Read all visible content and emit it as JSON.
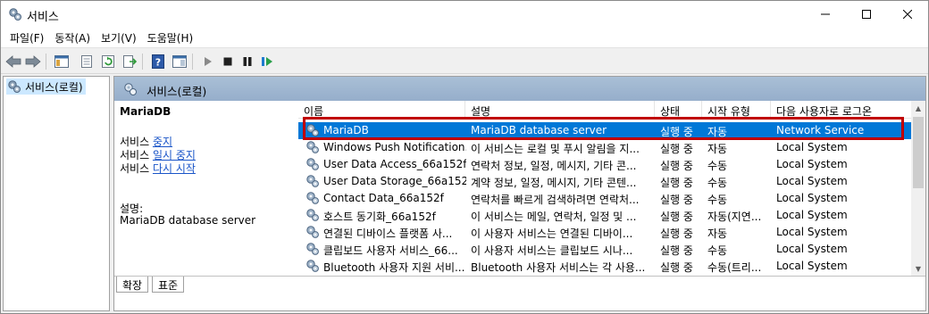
{
  "window": {
    "title": "서비스"
  },
  "menu": [
    "파일(F)",
    "동작(A)",
    "보기(V)",
    "도움말(H)"
  ],
  "tree": {
    "root": "서비스(로컬)"
  },
  "content_header": {
    "title": "서비스(로컬)"
  },
  "detail": {
    "service_name": "MariaDB",
    "actions": [
      {
        "prefix": "서비스 ",
        "link": "중지"
      },
      {
        "prefix": "서비스 ",
        "link": "일시 중지"
      },
      {
        "prefix": "서비스 ",
        "link": "다시 시작"
      }
    ],
    "desc_label": "설명:",
    "desc_text": "MariaDB database server"
  },
  "list": {
    "columns": [
      "이름",
      "설명",
      "상태",
      "시작 유형",
      "다음 사용자로 로그온"
    ],
    "rows": [
      [
        "MariaDB",
        "MariaDB database server",
        "실행 중",
        "자동",
        "Network Service"
      ],
      [
        "Windows Push Notification...",
        "이 서비스는 로컬 및 푸시 알림을 지...",
        "실행 중",
        "자동",
        "Local System"
      ],
      [
        "User Data Access_66a152f",
        "연락처 정보, 일정, 메시지, 기타 콘...",
        "실행 중",
        "수동",
        "Local System"
      ],
      [
        "User Data Storage_66a152f",
        "계약 정보, 일정, 메시지, 기타 콘텐...",
        "실행 중",
        "수동",
        "Local System"
      ],
      [
        "Contact Data_66a152f",
        "연락처를 빠르게 검색하려면 연락처...",
        "실행 중",
        "수동",
        "Local System"
      ],
      [
        "호스트 동기화_66a152f",
        "이 서비스는 메일, 연락처, 일정 및 ...",
        "실행 중",
        "자동(지연...",
        "Local System"
      ],
      [
        "연결된 디바이스 플랫폼 사...",
        "이 사용자 서비스는 연결된 디바이...",
        "실행 중",
        "자동",
        "Local System"
      ],
      [
        "클립보드 사용자 서비스_66...",
        "이 사용자 서비스는 클립보드 시나...",
        "실행 중",
        "수동",
        "Local System"
      ],
      [
        "Bluetooth 사용자 지원 서비...",
        "Bluetooth 사용자 서비스는 각 사용...",
        "실행 중",
        "수동(트리...",
        "Local System"
      ]
    ]
  },
  "tabs": [
    "확장",
    "표준"
  ],
  "colors": {
    "selection": "#0078d7",
    "highlight_outline": "#c00000",
    "link": "#1a55c8"
  }
}
